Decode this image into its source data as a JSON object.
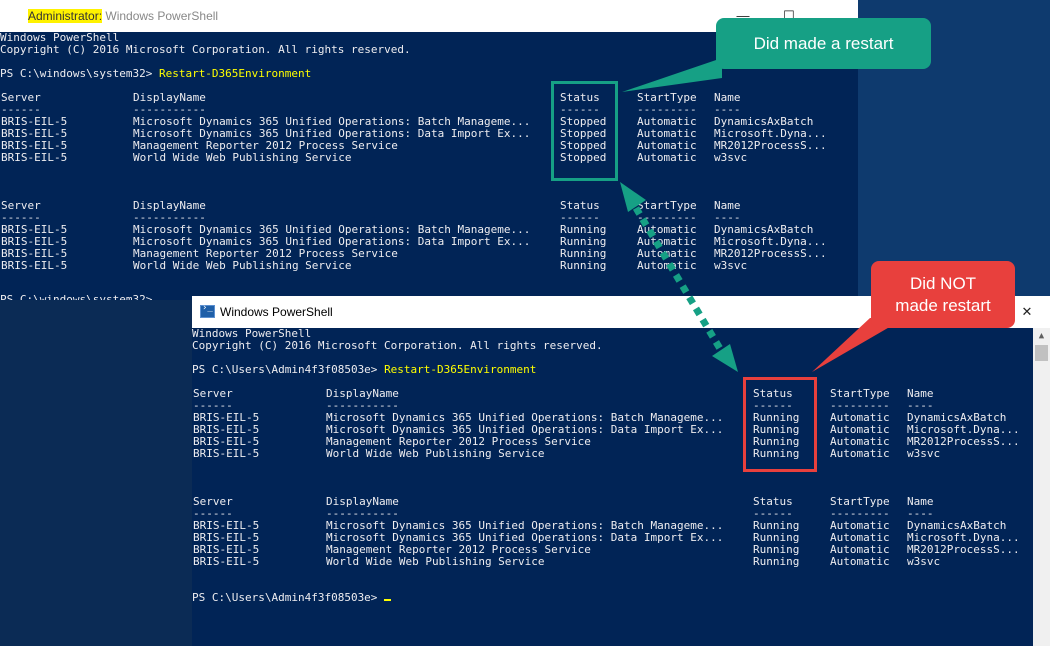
{
  "window1": {
    "title_highlight": "Administrator:",
    "title_rest": " Windows PowerShell",
    "lines": [
      "Windows PowerShell",
      "Copyright (C) 2016 Microsoft Corporation. All rights reserved.",
      "",
      "PS C:\\windows\\system32> ",
      "",
      "Server              DisplayName                                  Status     StartType  Name",
      "------              -----------                                  ------     ---------  ----",
      "BRIS-EIL-5          Microsoft Dynamics 365 Unified Operations: Batch Manageme... Stopped    Automatic  DynamicsAxBatch",
      "BRIS-EIL-5          Microsoft Dynamics 365 Unified Operations: Data Import Ex... Stopped    Automatic  Microsoft.Dyna...",
      "BRIS-EIL-5          Management Reporter 2012 Process Service          Stopped    Automatic  MR2012ProcessS...",
      "BRIS-EIL-5          World Wide Web Publishing Service                 Stopped    Automatic  w3svc"
    ],
    "command": "Restart-D365Environment",
    "prompt": "PS C:\\windows\\system32>",
    "table1": {
      "headers": [
        "Server",
        "DisplayName",
        "Status",
        "StartType",
        "Name"
      ],
      "dashes": [
        "------",
        "-----------",
        "------",
        "---------",
        "----"
      ],
      "rows": [
        [
          "BRIS-EIL-5",
          "Microsoft Dynamics 365 Unified Operations: Batch Manageme...",
          "Stopped",
          "Automatic",
          "DynamicsAxBatch"
        ],
        [
          "BRIS-EIL-5",
          "Microsoft Dynamics 365 Unified Operations: Data Import Ex...",
          "Stopped",
          "Automatic",
          "Microsoft.Dyna..."
        ],
        [
          "BRIS-EIL-5",
          "Management Reporter 2012 Process Service",
          "Stopped",
          "Automatic",
          "MR2012ProcessS..."
        ],
        [
          "BRIS-EIL-5",
          "World Wide Web Publishing Service",
          "Stopped",
          "Automatic",
          "w3svc"
        ]
      ]
    },
    "table2": {
      "headers": [
        "Server",
        "DisplayName",
        "Status",
        "StartType",
        "Name"
      ],
      "dashes": [
        "------",
        "-----------",
        "------",
        "---------",
        "----"
      ],
      "rows": [
        [
          "BRIS-EIL-5",
          "Microsoft Dynamics 365 Unified Operations: Batch Manageme...",
          "Running",
          "Automatic",
          "DynamicsAxBatch"
        ],
        [
          "BRIS-EIL-5",
          "Microsoft Dynamics 365 Unified Operations: Data Import Ex...",
          "Running",
          "Automatic",
          "Microsoft.Dyna..."
        ],
        [
          "BRIS-EIL-5",
          "Management Reporter 2012 Process Service",
          "Running",
          "Automatic",
          "MR2012ProcessS..."
        ],
        [
          "BRIS-EIL-5",
          "World Wide Web Publishing Service",
          "Running",
          "Automatic",
          "w3svc"
        ]
      ]
    }
  },
  "window2": {
    "title": "Windows PowerShell",
    "header_line1": "Windows PowerShell",
    "header_line2": "Copyright (C) 2016 Microsoft Corporation. All rights reserved.",
    "prompt": "PS C:\\Users\\Admin4f3f08503e>",
    "command": "Restart-D365Environment",
    "table1": {
      "headers": [
        "Server",
        "DisplayName",
        "Status",
        "StartType",
        "Name"
      ],
      "dashes": [
        "------",
        "-----------",
        "------",
        "---------",
        "----"
      ],
      "rows": [
        [
          "BRIS-EIL-5",
          "Microsoft Dynamics 365 Unified Operations: Batch Manageme...",
          "Running",
          "Automatic",
          "DynamicsAxBatch"
        ],
        [
          "BRIS-EIL-5",
          "Microsoft Dynamics 365 Unified Operations: Data Import Ex...",
          "Running",
          "Automatic",
          "Microsoft.Dyna..."
        ],
        [
          "BRIS-EIL-5",
          "Management Reporter 2012 Process Service",
          "Running",
          "Automatic",
          "MR2012ProcessS..."
        ],
        [
          "BRIS-EIL-5",
          "World Wide Web Publishing Service",
          "Running",
          "Automatic",
          "w3svc"
        ]
      ]
    },
    "table2": {
      "headers": [
        "Server",
        "DisplayName",
        "Status",
        "StartType",
        "Name"
      ],
      "dashes": [
        "------",
        "-----------",
        "------",
        "---------",
        "----"
      ],
      "rows": [
        [
          "BRIS-EIL-5",
          "Microsoft Dynamics 365 Unified Operations: Batch Manageme...",
          "Running",
          "Automatic",
          "DynamicsAxBatch"
        ],
        [
          "BRIS-EIL-5",
          "Microsoft Dynamics 365 Unified Operations: Data Import Ex...",
          "Running",
          "Automatic",
          "Microsoft.Dyna..."
        ],
        [
          "BRIS-EIL-5",
          "Management Reporter 2012 Process Service",
          "Running",
          "Automatic",
          "MR2012ProcessS..."
        ],
        [
          "BRIS-EIL-5",
          "World Wide Web Publishing Service",
          "Running",
          "Automatic",
          "w3svc"
        ]
      ]
    },
    "close_glyph": "✕"
  },
  "callouts": {
    "green": "Did made a restart",
    "red_line1": "Did NOT",
    "red_line2": "made restart"
  },
  "colors": {
    "console_bg": "#012456",
    "console_text": "#eeedf0",
    "command_text": "#ffff00",
    "green_callout": "#16a085",
    "red_callout": "#e8403d",
    "title_highlight": "#fff200"
  }
}
